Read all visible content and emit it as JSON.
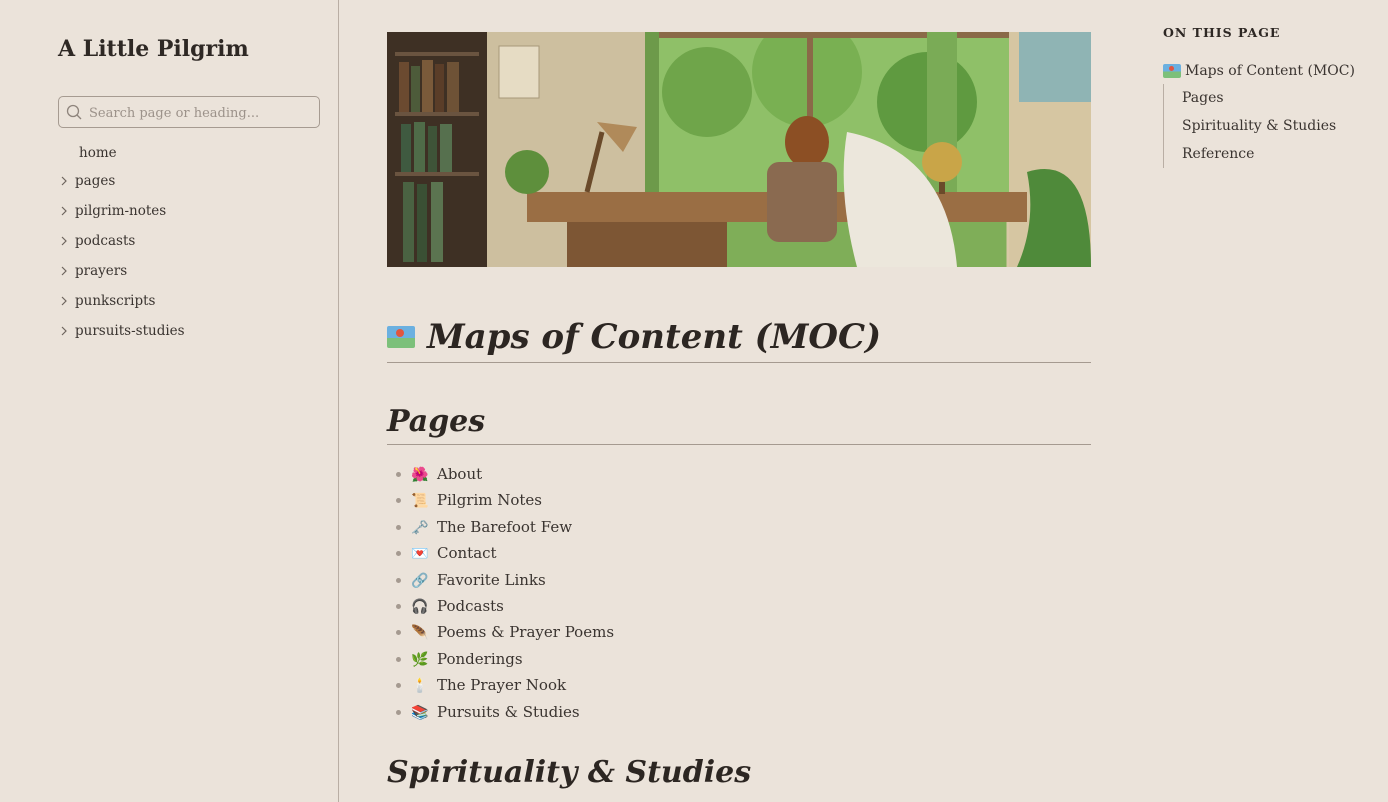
{
  "site": {
    "title": "A Little Pilgrim"
  },
  "search": {
    "placeholder": "Search page or heading..."
  },
  "nav": {
    "home": "home",
    "items": [
      {
        "label": "pages"
      },
      {
        "label": "pilgrim-notes"
      },
      {
        "label": "podcasts"
      },
      {
        "label": "prayers"
      },
      {
        "label": "punkscripts"
      },
      {
        "label": "pursuits-studies"
      }
    ]
  },
  "main": {
    "title": "Maps of Content (MOC)",
    "pages_heading": "Pages",
    "pages": [
      {
        "emoji": "🌺",
        "label": "About"
      },
      {
        "emoji": "📜",
        "label": "Pilgrim Notes"
      },
      {
        "emoji": "🗝️",
        "label": "The Barefoot Few"
      },
      {
        "emoji": "💌",
        "label": "Contact"
      },
      {
        "emoji": "🔗",
        "label": "Favorite Links"
      },
      {
        "emoji": "🎧",
        "label": "Podcasts"
      },
      {
        "emoji": "🪶",
        "label": "Poems & Prayer Poems"
      },
      {
        "emoji": "🌿",
        "label": "Ponderings"
      },
      {
        "emoji": "🕯️",
        "label": "The Prayer Nook"
      },
      {
        "emoji": "📚",
        "label": "Pursuits & Studies"
      }
    ],
    "next_heading": "Spirituality & Studies"
  },
  "toc": {
    "title": "ON THIS PAGE",
    "top": "Maps of Content (MOC)",
    "items": [
      "Pages",
      "Spirituality & Studies",
      "Reference"
    ]
  },
  "icons": {
    "search": "search-icon",
    "chevron": "chevron-right-icon",
    "map": "world-map-icon"
  },
  "colors": {
    "background": "#ebe3da",
    "text": "#3a3430",
    "rule": "#a59a90"
  }
}
